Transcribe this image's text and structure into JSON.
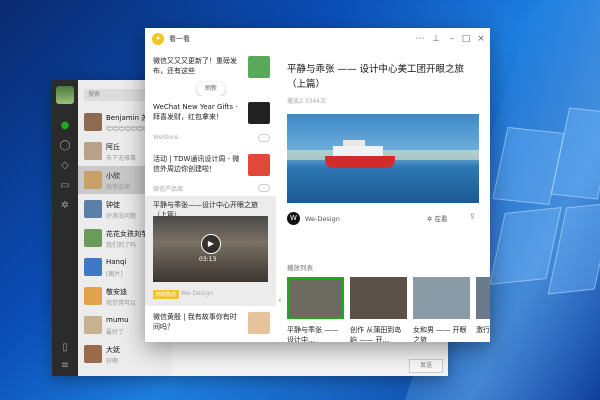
{
  "desktop": {},
  "chat_window": {
    "search_placeholder": "搜索",
    "send_label": "发送",
    "conversations": [
      {
        "name": "Benjamin 苏",
        "snippet": "哈哈哈哈哈哈哈",
        "color": "#8d6b52"
      },
      {
        "name": "阿丘",
        "snippet": "天下无难事",
        "color": "#b7a188"
      },
      {
        "name": "小欣",
        "snippet": "我等会来",
        "color": "#c8a06a",
        "selected": true
      },
      {
        "name": "钟徒",
        "snippet": "好滴没问题",
        "color": "#5b7fa7"
      },
      {
        "name": "花花女孩刘芋",
        "snippet": "我们到了吗",
        "color": "#6a9b5a"
      },
      {
        "name": "Hanqi",
        "snippet": "[图片]",
        "color": "#3f79c6"
      },
      {
        "name": "敬安迪",
        "snippet": "我觉得可以",
        "color": "#e0a34a"
      },
      {
        "name": "mumu",
        "snippet": "最好了",
        "color": "#c8b090"
      },
      {
        "name": "大妩",
        "snippet": "好啊",
        "color": "#9a6a4a"
      }
    ]
  },
  "top_stories_window": {
    "title": "看一看",
    "refresh_label": "刷新",
    "feed": [
      {
        "title": "微信又又又更新了！重磅发布，还有这些",
        "source": "功能爆料",
        "thumb": "#5aa85a"
      },
      {
        "title": "WeChat New Year Gifts -拜喜发财，红包拿来！",
        "source": "WeStore",
        "thumb": "#222222"
      },
      {
        "title": "活动 | TDW通讯设计周 - 微信外周边你创建啦！",
        "source": "微信产品周",
        "thumb": "#e2483a"
      },
      {
        "title": "平静与乖张——设计中心开眼之旅（上篇）",
        "source": "We-Design",
        "tag": "你的热点",
        "video_time": "03:13"
      },
      {
        "title": "微信黄殷 | 我有故事你有时间吗？",
        "source": "",
        "thumb": "#e7c39b"
      }
    ],
    "article": {
      "title": "平静与乖张 —— 设计中心美工团开眼之旅（上篇）",
      "plays": "播放2.3344次",
      "author": "We-Design",
      "author_logo": "W",
      "seeing_label": "在看",
      "playlist_label": "播放列表",
      "playlist": [
        {
          "title": "平静与乖张 —— 设计中...",
          "selected": true,
          "color": "#6d6a60"
        },
        {
          "title": "创作 从蒲田到岛屿 —— 开...",
          "color": "#5b5149"
        },
        {
          "title": "女和男 —— 开眼之旅",
          "color": "#8a9aa6"
        },
        {
          "title": "激行",
          "color": "#6b7a8a"
        }
      ]
    },
    "accent": "#1aad19"
  }
}
